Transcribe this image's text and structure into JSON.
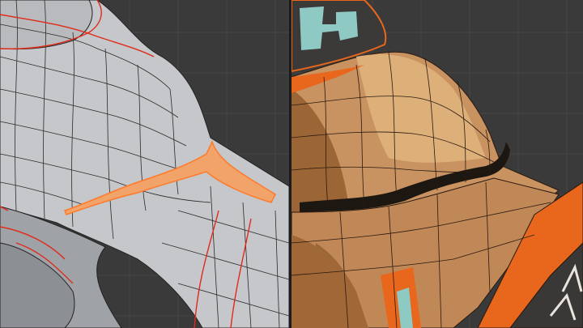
{
  "viewports": {
    "left": {
      "shading": "solid",
      "colors": {
        "background": "#3a3a3a",
        "grid": "#444444",
        "mesh": "#c7c9cc",
        "mesh_dark": "#8f9296",
        "wire": "#1e1e1e",
        "seam": "#e02a1a",
        "selected_face": "#f1a36a",
        "selected_edge": "#ff7a2a"
      }
    },
    "right": {
      "shading": "textured",
      "colors": {
        "background": "#3a3a3a",
        "grid": "#444444",
        "skin": "#c99361",
        "skin_light": "#ddb07a",
        "skin_dark": "#9b6535",
        "wire": "#2a1a10",
        "band_orange": "#e8671c",
        "band_dark": "#3a3837",
        "pattern_teal": "#8ec9c4",
        "gap": "#1d1712"
      }
    }
  }
}
